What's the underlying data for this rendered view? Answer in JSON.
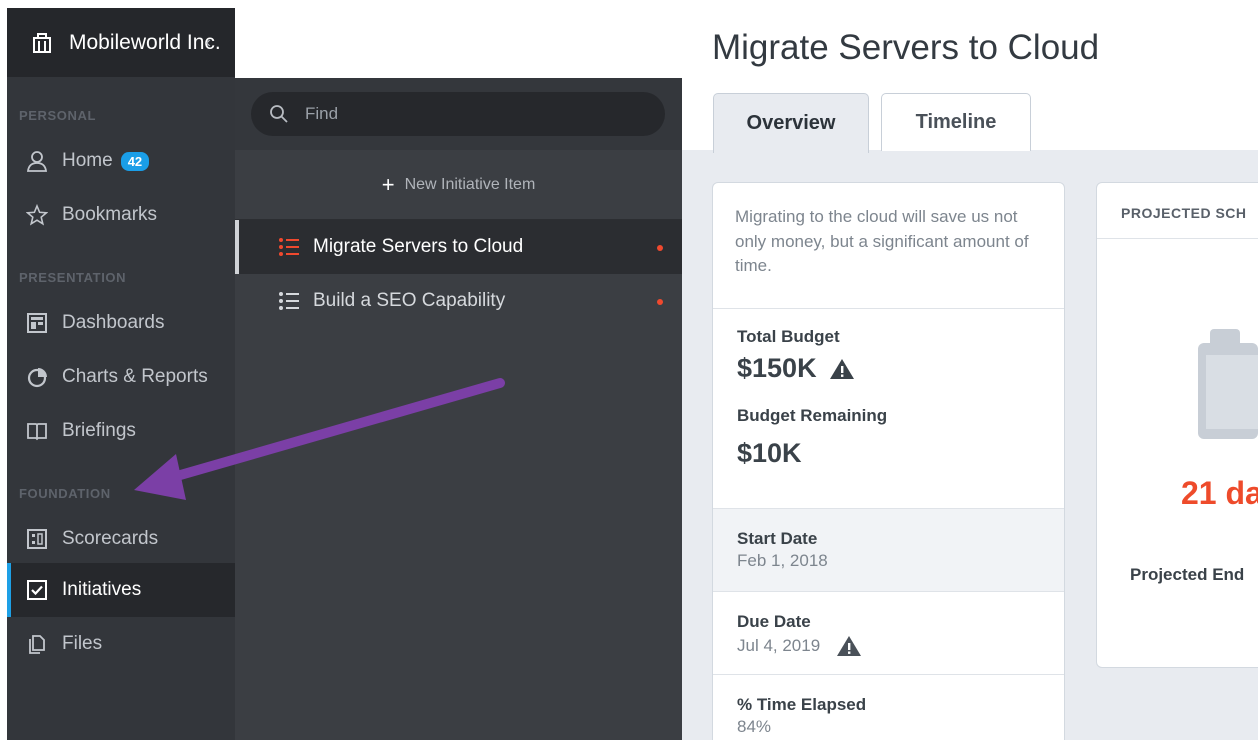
{
  "sidebar": {
    "org_name": "Mobileworld Inc.",
    "sections": {
      "personal": "PERSONAL",
      "presentation": "PRESENTATION",
      "foundation": "FOUNDATION"
    },
    "items": [
      {
        "label": "Home",
        "icon": "user-icon",
        "badge": "42"
      },
      {
        "label": "Bookmarks",
        "icon": "star-icon"
      },
      {
        "label": "Dashboards",
        "icon": "dashboard-icon"
      },
      {
        "label": "Charts & Reports",
        "icon": "pie-chart-icon"
      },
      {
        "label": "Briefings",
        "icon": "book-icon"
      },
      {
        "label": "Scorecards",
        "icon": "scorecard-icon"
      },
      {
        "label": "Initiatives",
        "icon": "checkbox-icon",
        "active": true
      },
      {
        "label": "Files",
        "icon": "files-icon"
      }
    ]
  },
  "list": {
    "search_placeholder": "Find",
    "new_item_label": "New Initiative Item",
    "items": [
      {
        "label": "Migrate Servers to Cloud",
        "selected": true
      },
      {
        "label": "Build a SEO Capability"
      }
    ]
  },
  "main": {
    "title": "Migrate Servers to Cloud",
    "tabs": [
      "Overview",
      "Timeline"
    ],
    "description": "Migrating to the cloud will save us not only money, but a significant amount of time.",
    "total_budget_label": "Total Budget",
    "total_budget_value": "$150K",
    "budget_remaining_label": "Budget Remaining",
    "budget_remaining_value": "$10K",
    "start_date_label": "Start Date",
    "start_date_value": "Feb 1, 2018",
    "due_date_label": "Due Date",
    "due_date_value": "Jul 4, 2019",
    "time_elapsed_label": "% Time Elapsed",
    "time_elapsed_value": "84%",
    "schedule_header": "PROJECTED SCH",
    "days_value": "21 da",
    "projected_end_label": "Projected End"
  },
  "colors": {
    "accent_blue": "#1ea0e6",
    "alert_red": "#ee4b2b",
    "annotation_purple": "#7b3fa6"
  }
}
